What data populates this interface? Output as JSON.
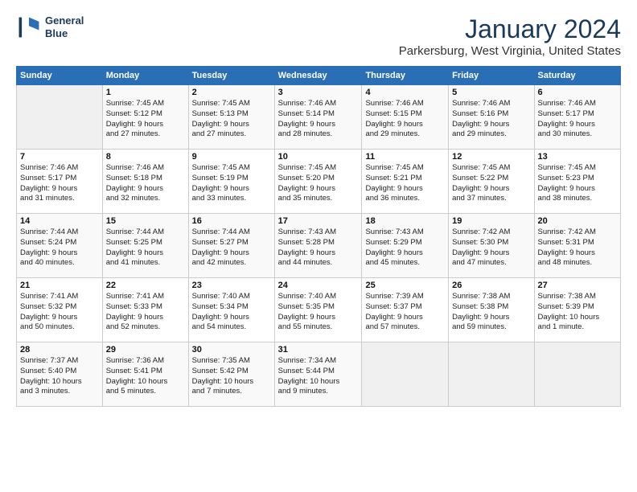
{
  "logo": {
    "line1": "General",
    "line2": "Blue"
  },
  "header": {
    "month": "January 2024",
    "location": "Parkersburg, West Virginia, United States"
  },
  "weekdays": [
    "Sunday",
    "Monday",
    "Tuesday",
    "Wednesday",
    "Thursday",
    "Friday",
    "Saturday"
  ],
  "weeks": [
    [
      {
        "day": "",
        "info": ""
      },
      {
        "day": "1",
        "info": "Sunrise: 7:45 AM\nSunset: 5:12 PM\nDaylight: 9 hours\nand 27 minutes."
      },
      {
        "day": "2",
        "info": "Sunrise: 7:45 AM\nSunset: 5:13 PM\nDaylight: 9 hours\nand 27 minutes."
      },
      {
        "day": "3",
        "info": "Sunrise: 7:46 AM\nSunset: 5:14 PM\nDaylight: 9 hours\nand 28 minutes."
      },
      {
        "day": "4",
        "info": "Sunrise: 7:46 AM\nSunset: 5:15 PM\nDaylight: 9 hours\nand 29 minutes."
      },
      {
        "day": "5",
        "info": "Sunrise: 7:46 AM\nSunset: 5:16 PM\nDaylight: 9 hours\nand 29 minutes."
      },
      {
        "day": "6",
        "info": "Sunrise: 7:46 AM\nSunset: 5:17 PM\nDaylight: 9 hours\nand 30 minutes."
      }
    ],
    [
      {
        "day": "7",
        "info": "Sunrise: 7:46 AM\nSunset: 5:17 PM\nDaylight: 9 hours\nand 31 minutes."
      },
      {
        "day": "8",
        "info": "Sunrise: 7:46 AM\nSunset: 5:18 PM\nDaylight: 9 hours\nand 32 minutes."
      },
      {
        "day": "9",
        "info": "Sunrise: 7:45 AM\nSunset: 5:19 PM\nDaylight: 9 hours\nand 33 minutes."
      },
      {
        "day": "10",
        "info": "Sunrise: 7:45 AM\nSunset: 5:20 PM\nDaylight: 9 hours\nand 35 minutes."
      },
      {
        "day": "11",
        "info": "Sunrise: 7:45 AM\nSunset: 5:21 PM\nDaylight: 9 hours\nand 36 minutes."
      },
      {
        "day": "12",
        "info": "Sunrise: 7:45 AM\nSunset: 5:22 PM\nDaylight: 9 hours\nand 37 minutes."
      },
      {
        "day": "13",
        "info": "Sunrise: 7:45 AM\nSunset: 5:23 PM\nDaylight: 9 hours\nand 38 minutes."
      }
    ],
    [
      {
        "day": "14",
        "info": "Sunrise: 7:44 AM\nSunset: 5:24 PM\nDaylight: 9 hours\nand 40 minutes."
      },
      {
        "day": "15",
        "info": "Sunrise: 7:44 AM\nSunset: 5:25 PM\nDaylight: 9 hours\nand 41 minutes."
      },
      {
        "day": "16",
        "info": "Sunrise: 7:44 AM\nSunset: 5:27 PM\nDaylight: 9 hours\nand 42 minutes."
      },
      {
        "day": "17",
        "info": "Sunrise: 7:43 AM\nSunset: 5:28 PM\nDaylight: 9 hours\nand 44 minutes."
      },
      {
        "day": "18",
        "info": "Sunrise: 7:43 AM\nSunset: 5:29 PM\nDaylight: 9 hours\nand 45 minutes."
      },
      {
        "day": "19",
        "info": "Sunrise: 7:42 AM\nSunset: 5:30 PM\nDaylight: 9 hours\nand 47 minutes."
      },
      {
        "day": "20",
        "info": "Sunrise: 7:42 AM\nSunset: 5:31 PM\nDaylight: 9 hours\nand 48 minutes."
      }
    ],
    [
      {
        "day": "21",
        "info": "Sunrise: 7:41 AM\nSunset: 5:32 PM\nDaylight: 9 hours\nand 50 minutes."
      },
      {
        "day": "22",
        "info": "Sunrise: 7:41 AM\nSunset: 5:33 PM\nDaylight: 9 hours\nand 52 minutes."
      },
      {
        "day": "23",
        "info": "Sunrise: 7:40 AM\nSunset: 5:34 PM\nDaylight: 9 hours\nand 54 minutes."
      },
      {
        "day": "24",
        "info": "Sunrise: 7:40 AM\nSunset: 5:35 PM\nDaylight: 9 hours\nand 55 minutes."
      },
      {
        "day": "25",
        "info": "Sunrise: 7:39 AM\nSunset: 5:37 PM\nDaylight: 9 hours\nand 57 minutes."
      },
      {
        "day": "26",
        "info": "Sunrise: 7:38 AM\nSunset: 5:38 PM\nDaylight: 9 hours\nand 59 minutes."
      },
      {
        "day": "27",
        "info": "Sunrise: 7:38 AM\nSunset: 5:39 PM\nDaylight: 10 hours\nand 1 minute."
      }
    ],
    [
      {
        "day": "28",
        "info": "Sunrise: 7:37 AM\nSunset: 5:40 PM\nDaylight: 10 hours\nand 3 minutes."
      },
      {
        "day": "29",
        "info": "Sunrise: 7:36 AM\nSunset: 5:41 PM\nDaylight: 10 hours\nand 5 minutes."
      },
      {
        "day": "30",
        "info": "Sunrise: 7:35 AM\nSunset: 5:42 PM\nDaylight: 10 hours\nand 7 minutes."
      },
      {
        "day": "31",
        "info": "Sunrise: 7:34 AM\nSunset: 5:44 PM\nDaylight: 10 hours\nand 9 minutes."
      },
      {
        "day": "",
        "info": ""
      },
      {
        "day": "",
        "info": ""
      },
      {
        "day": "",
        "info": ""
      }
    ]
  ]
}
